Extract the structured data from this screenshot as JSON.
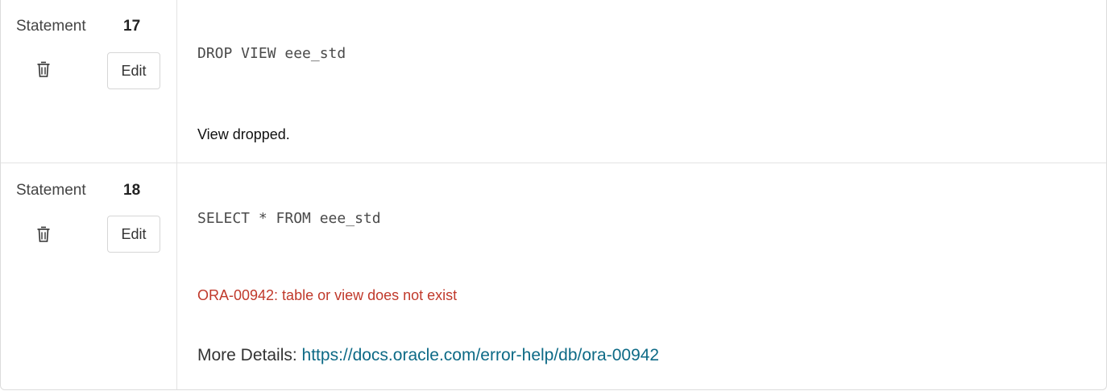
{
  "statements": [
    {
      "label": "Statement",
      "number": "17",
      "edit_label": "Edit",
      "sql": "DROP VIEW eee_std",
      "result": "View dropped."
    },
    {
      "label": "Statement",
      "number": "18",
      "edit_label": "Edit",
      "sql": "SELECT * FROM eee_std",
      "error": "ORA-00942: table or view does not exist",
      "details_label": "More Details: ",
      "details_link": "https://docs.oracle.com/error-help/db/ora-00942"
    }
  ],
  "colors": {
    "error": "#c0392b",
    "link": "#0d6a86"
  },
  "icons": {
    "delete": "trash-icon"
  }
}
